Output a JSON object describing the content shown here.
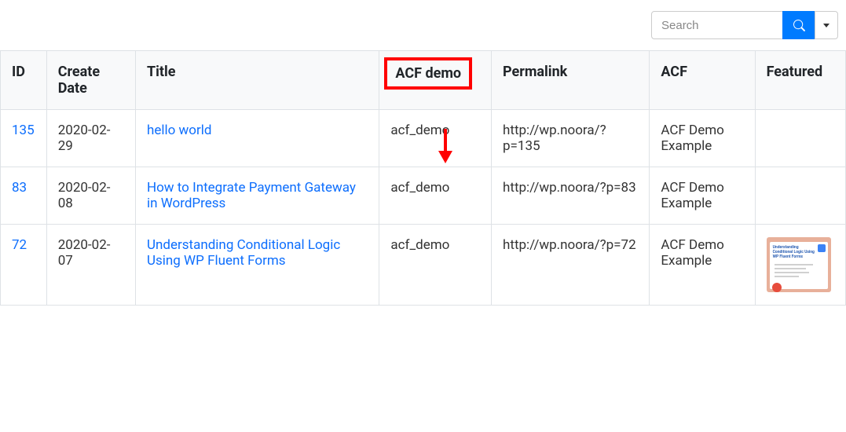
{
  "search": {
    "placeholder": "Search",
    "value": ""
  },
  "columns": {
    "id": "ID",
    "create_date": "Create Date",
    "title": "Title",
    "acf_demo": "ACF demo",
    "permalink": "Permalink",
    "acf": "ACF",
    "featured": "Featured"
  },
  "rows": [
    {
      "id": "135",
      "create_date": "2020-02-29",
      "title": "hello world",
      "acf_demo": "acf_demo",
      "permalink": "http://wp.noora/?p=135",
      "acf": "ACF Demo Example",
      "featured": null
    },
    {
      "id": "83",
      "create_date": "2020-02-08",
      "title": "How to Integrate Payment Gateway in WordPress",
      "acf_demo": "acf_demo",
      "permalink": "http://wp.noora/?p=83",
      "acf": "ACF Demo Example",
      "featured": null
    },
    {
      "id": "72",
      "create_date": "2020-02-07",
      "title": "Understanding Conditional Logic Using WP Fluent Forms",
      "acf_demo": "acf_demo",
      "permalink": "http://wp.noora/?p=72",
      "acf": "ACF Demo Example",
      "featured": "thumbnail"
    }
  ],
  "annotation": {
    "highlight_column": "acf_demo",
    "arrow_color": "#ff0000"
  },
  "thumbnail_caption": "Understanding Conditional Logic Using WP Fluent Forms"
}
